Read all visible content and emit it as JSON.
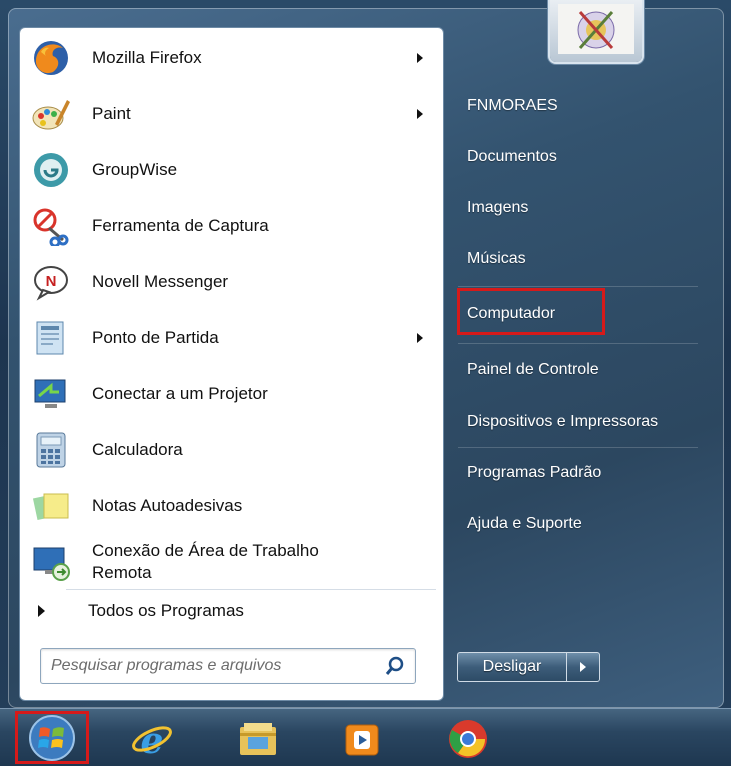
{
  "programs": [
    {
      "label": "Mozilla Firefox",
      "icon": "firefox-icon",
      "submenu": true
    },
    {
      "label": "Paint",
      "icon": "paint-icon",
      "submenu": true
    },
    {
      "label": "GroupWise",
      "icon": "groupwise-icon",
      "submenu": false
    },
    {
      "label": "Ferramenta de Captura",
      "icon": "snipping-tool-icon",
      "submenu": false
    },
    {
      "label": "Novell Messenger",
      "icon": "novell-messenger-icon",
      "submenu": false
    },
    {
      "label": "Ponto de Partida",
      "icon": "getting-started-icon",
      "submenu": true
    },
    {
      "label": "Conectar a um Projetor",
      "icon": "projector-icon",
      "submenu": false
    },
    {
      "label": "Calculadora",
      "icon": "calculator-icon",
      "submenu": false
    },
    {
      "label": "Notas Autoadesivas",
      "icon": "sticky-notes-icon",
      "submenu": false
    },
    {
      "label_line1": "Conexão de Área de Trabalho",
      "label_line2": "Remota",
      "icon": "remote-desktop-icon",
      "submenu": false
    }
  ],
  "all_programs_label": "Todos os Programas",
  "search": {
    "placeholder": "Pesquisar programas e arquivos"
  },
  "right_items": [
    {
      "label": "FNMORAES"
    },
    {
      "label": "Documentos"
    },
    {
      "label": "Imagens"
    },
    {
      "label": "Músicas"
    },
    {
      "label": "Computador",
      "highlighted": true
    },
    {
      "label": "Painel de Controle"
    },
    {
      "label": "Dispositivos e Impressoras"
    },
    {
      "label": "Programas Padrão"
    },
    {
      "label": "Ajuda e Suporte"
    }
  ],
  "shutdown_label": "Desligar",
  "taskbar": [
    {
      "icon": "start-orb-icon",
      "highlighted": true
    },
    {
      "icon": "internet-explorer-icon"
    },
    {
      "icon": "file-explorer-icon"
    },
    {
      "icon": "media-player-icon"
    },
    {
      "icon": "chrome-icon"
    }
  ],
  "colors": {
    "highlight": "#d61a1a",
    "menu_bg": "#ffffff",
    "glass": "#33536f"
  }
}
